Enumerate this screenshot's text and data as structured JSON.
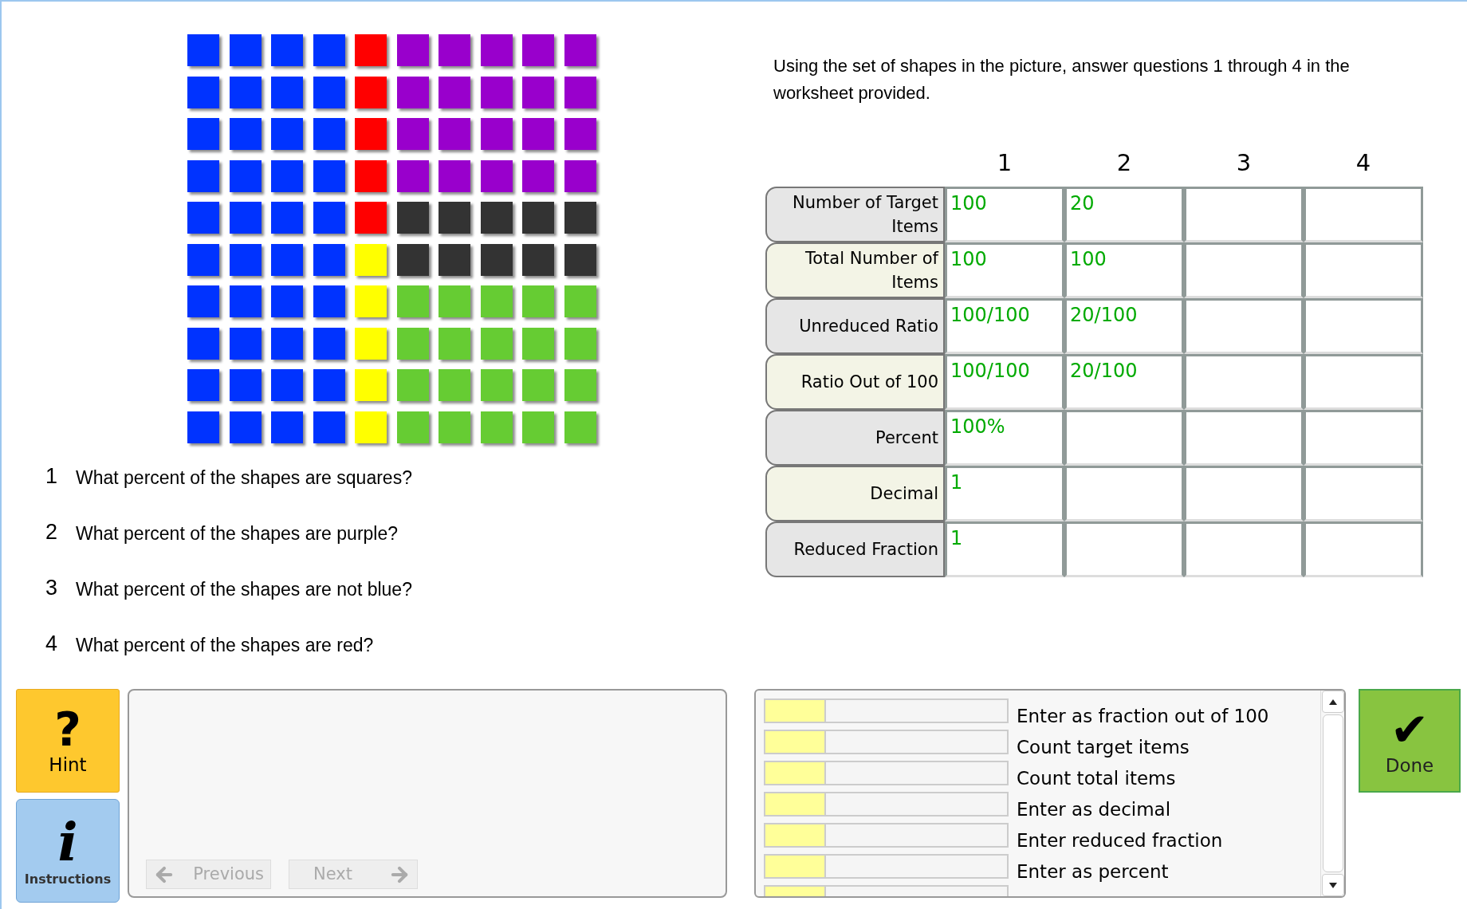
{
  "shape_grid": {
    "rows": [
      {
        "cells": [
          {
            "color": "#0033ff"
          },
          {
            "color": "#0033ff"
          },
          {
            "color": "#0033ff"
          },
          {
            "color": "#0033ff"
          },
          {
            "color": "#ff0000"
          },
          {
            "color": "#9900cc"
          },
          {
            "color": "#9900cc"
          },
          {
            "color": "#9900cc"
          },
          {
            "color": "#9900cc"
          },
          {
            "color": "#9900cc"
          }
        ]
      },
      {
        "cells": [
          {
            "color": "#0033ff"
          },
          {
            "color": "#0033ff"
          },
          {
            "color": "#0033ff"
          },
          {
            "color": "#0033ff"
          },
          {
            "color": "#ff0000"
          },
          {
            "color": "#9900cc"
          },
          {
            "color": "#9900cc"
          },
          {
            "color": "#9900cc"
          },
          {
            "color": "#9900cc"
          },
          {
            "color": "#9900cc"
          }
        ]
      },
      {
        "cells": [
          {
            "color": "#0033ff"
          },
          {
            "color": "#0033ff"
          },
          {
            "color": "#0033ff"
          },
          {
            "color": "#0033ff"
          },
          {
            "color": "#ff0000"
          },
          {
            "color": "#9900cc"
          },
          {
            "color": "#9900cc"
          },
          {
            "color": "#9900cc"
          },
          {
            "color": "#9900cc"
          },
          {
            "color": "#9900cc"
          }
        ]
      },
      {
        "cells": [
          {
            "color": "#0033ff"
          },
          {
            "color": "#0033ff"
          },
          {
            "color": "#0033ff"
          },
          {
            "color": "#0033ff"
          },
          {
            "color": "#ff0000"
          },
          {
            "color": "#9900cc"
          },
          {
            "color": "#9900cc"
          },
          {
            "color": "#9900cc"
          },
          {
            "color": "#9900cc"
          },
          {
            "color": "#9900cc"
          }
        ]
      },
      {
        "cells": [
          {
            "color": "#0033ff"
          },
          {
            "color": "#0033ff"
          },
          {
            "color": "#0033ff"
          },
          {
            "color": "#0033ff"
          },
          {
            "color": "#ff0000"
          },
          {
            "color": "#333333"
          },
          {
            "color": "#333333"
          },
          {
            "color": "#333333"
          },
          {
            "color": "#333333"
          },
          {
            "color": "#333333"
          }
        ]
      },
      {
        "cells": [
          {
            "color": "#0033ff"
          },
          {
            "color": "#0033ff"
          },
          {
            "color": "#0033ff"
          },
          {
            "color": "#0033ff"
          },
          {
            "color": "#ffff00"
          },
          {
            "color": "#333333"
          },
          {
            "color": "#333333"
          },
          {
            "color": "#333333"
          },
          {
            "color": "#333333"
          },
          {
            "color": "#333333"
          }
        ]
      },
      {
        "cells": [
          {
            "color": "#0033ff"
          },
          {
            "color": "#0033ff"
          },
          {
            "color": "#0033ff"
          },
          {
            "color": "#0033ff"
          },
          {
            "color": "#ffff00"
          },
          {
            "color": "#66cc33"
          },
          {
            "color": "#66cc33"
          },
          {
            "color": "#66cc33"
          },
          {
            "color": "#66cc33"
          },
          {
            "color": "#66cc33"
          }
        ]
      },
      {
        "cells": [
          {
            "color": "#0033ff"
          },
          {
            "color": "#0033ff"
          },
          {
            "color": "#0033ff"
          },
          {
            "color": "#0033ff"
          },
          {
            "color": "#ffff00"
          },
          {
            "color": "#66cc33"
          },
          {
            "color": "#66cc33"
          },
          {
            "color": "#66cc33"
          },
          {
            "color": "#66cc33"
          },
          {
            "color": "#66cc33"
          }
        ]
      },
      {
        "cells": [
          {
            "color": "#0033ff"
          },
          {
            "color": "#0033ff"
          },
          {
            "color": "#0033ff"
          },
          {
            "color": "#0033ff"
          },
          {
            "color": "#ffff00"
          },
          {
            "color": "#66cc33"
          },
          {
            "color": "#66cc33"
          },
          {
            "color": "#66cc33"
          },
          {
            "color": "#66cc33"
          },
          {
            "color": "#66cc33"
          }
        ]
      },
      {
        "cells": [
          {
            "color": "#0033ff"
          },
          {
            "color": "#0033ff"
          },
          {
            "color": "#0033ff"
          },
          {
            "color": "#0033ff"
          },
          {
            "color": "#ffff00"
          },
          {
            "color": "#66cc33"
          },
          {
            "color": "#66cc33"
          },
          {
            "color": "#66cc33"
          },
          {
            "color": "#66cc33"
          },
          {
            "color": "#66cc33"
          }
        ]
      }
    ]
  },
  "questions": [
    {
      "number": "1",
      "text": "What percent of the shapes are squares?"
    },
    {
      "number": "2",
      "text": "What percent of the shapes are purple?"
    },
    {
      "number": "3",
      "text": "What percent of the shapes are not blue?"
    },
    {
      "number": "4",
      "text": "What percent of the shapes are red?"
    }
  ],
  "instructions": "Using the set of shapes in the picture, answer questions 1 through 4 in the worksheet provided.",
  "worksheet": {
    "columns": [
      "1",
      "2",
      "3",
      "4"
    ],
    "rows": [
      {
        "label": "Number of Target Items",
        "values": [
          "100",
          "20"
        ]
      },
      {
        "label": "Total Number of Items",
        "values": [
          "100",
          "100"
        ]
      },
      {
        "label": "Unreduced Ratio",
        "values": [
          "100/100",
          "20/100"
        ]
      },
      {
        "label": "Ratio Out of 100",
        "values": [
          "100/100",
          "20/100"
        ]
      },
      {
        "label": "Percent",
        "values": [
          "100%"
        ]
      },
      {
        "label": "Decimal",
        "values": [
          "1"
        ]
      },
      {
        "label": "Reduced Fraction",
        "values": [
          "1"
        ]
      }
    ]
  },
  "hint_button": {
    "icon": "?",
    "label": "Hint"
  },
  "instructions_button": {
    "icon": "i",
    "label": "Instructions"
  },
  "navigation": [
    {
      "kind": "previous",
      "label": "Previous",
      "disabled": true
    },
    {
      "kind": "next",
      "label": "Next",
      "disabled": true
    }
  ],
  "checklist": [
    {
      "text": "Enter as fraction out of 100",
      "level": 0.25
    },
    {
      "text": "Count target items",
      "level": 0.25
    },
    {
      "text": "Count total items",
      "level": 0.25
    },
    {
      "text": "Enter as decimal",
      "level": 0.25
    },
    {
      "text": "Enter reduced fraction",
      "level": 0.25
    },
    {
      "text": "Enter as percent",
      "level": 0.25
    },
    {
      "level": 0.25
    }
  ],
  "done_button": {
    "icon": "✔",
    "label": "Done"
  }
}
